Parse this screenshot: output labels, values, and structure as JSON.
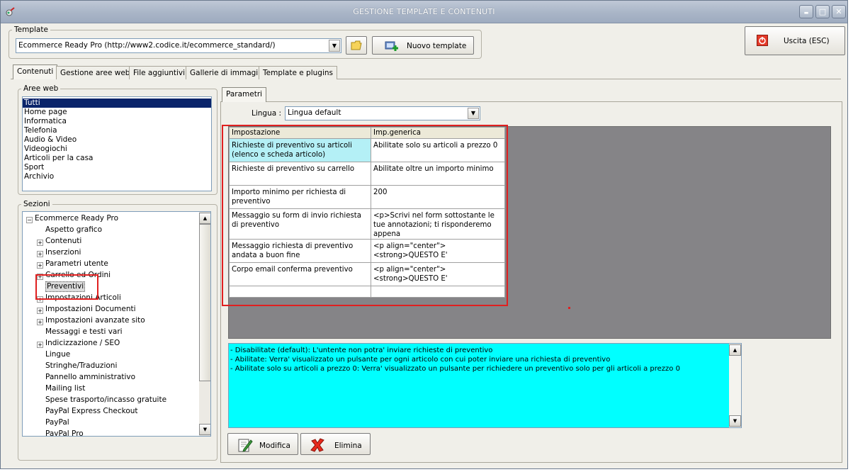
{
  "window": {
    "title": "GESTIONE TEMPLATE E CONTENUTI",
    "controls": {
      "minimize": "▬",
      "maximize": "□",
      "close": "✕"
    }
  },
  "template": {
    "group_label": "Template",
    "selected": "Ecommerce Ready Pro (http://www2.codice.it/ecommerce_standard/)",
    "new_template_label": "Nuovo template",
    "exit_label": "Uscita (ESC)"
  },
  "tabs": [
    "Contenuti",
    "Gestione aree web",
    "File aggiuntivi",
    "Gallerie di immagini",
    "Template e plugins"
  ],
  "aree_web": {
    "label": "Aree web",
    "items": [
      "Tutti",
      "Home page",
      "Informatica",
      "Telefonia",
      "Audio & Video",
      "Videogiochi",
      "Articoli per la casa",
      "Sport",
      "Archivio"
    ],
    "selected_index": 0
  },
  "sezioni": {
    "label": "Sezioni",
    "root": "Ecommerce Ready Pro",
    "items": [
      {
        "label": "Aspetto grafico",
        "expandable": false
      },
      {
        "label": "Contenuti",
        "expandable": true
      },
      {
        "label": "Inserzioni",
        "expandable": true
      },
      {
        "label": "Parametri utente",
        "expandable": true
      },
      {
        "label": "Carrello ed Ordini",
        "expandable": true
      },
      {
        "label": "Preventivi",
        "expandable": false,
        "selected": true
      },
      {
        "label": "Impostazioni Articoli",
        "expandable": true
      },
      {
        "label": "Impostazioni Documenti",
        "expandable": true
      },
      {
        "label": "Impostazioni avanzate sito",
        "expandable": true
      },
      {
        "label": "Messaggi e testi vari",
        "expandable": false
      },
      {
        "label": "Indicizzazione / SEO",
        "expandable": true
      },
      {
        "label": "Lingue",
        "expandable": false
      },
      {
        "label": "Stringhe/Traduzioni",
        "expandable": false
      },
      {
        "label": "Pannello amministrativo",
        "expandable": false
      },
      {
        "label": "Mailing list",
        "expandable": false
      },
      {
        "label": "Spese trasporto/incasso gratuite",
        "expandable": false
      },
      {
        "label": "PayPal Express Checkout",
        "expandable": false
      },
      {
        "label": "PayPal",
        "expandable": false
      },
      {
        "label": "PayPal Pro",
        "expandable": false
      }
    ]
  },
  "parametri": {
    "tab_label": "Parametri",
    "lingua_label": "Lingua :",
    "lingua_value": "Lingua default",
    "columns": [
      "Impostazione",
      "Imp.generica"
    ],
    "rows": [
      {
        "setting": "Richieste di preventivo su articoli (elenco e scheda articolo)",
        "value": "Abilitate solo su articoli a prezzo 0",
        "selected": true
      },
      {
        "setting": "Richieste di preventivo su carrello",
        "value": "Abilitate oltre un importo minimo"
      },
      {
        "setting": "Importo minimo per richiesta di preventivo",
        "value": "200"
      },
      {
        "setting": "Messaggio su form di invio richiesta di preventivo",
        "value": "<p>Scrivi nel form sottostante le tue annotazioni; ti risponderemo appena"
      },
      {
        "setting": "Messaggio richiesta di preventivo andata a buon fine",
        "value": "<p align=\"center\"><strong>QUESTO E'"
      },
      {
        "setting": "Corpo email conferma preventivo",
        "value": "<p align=\"center\"><strong>QUESTO E'"
      },
      {
        "setting": "",
        "value": ""
      }
    ]
  },
  "help_text": [
    "- Disabilitate (default): L'untente non potra' inviare richieste di preventivo",
    "- Abilitate: Verra' visualizzato un pulsante per ogni articolo con cui poter inviare una richiesta di preventivo",
    "- Abilitate solo su articoli a prezzo 0: Verra' visualizzato un pulsante per richiedere un preventivo solo per gli articoli a prezzo 0"
  ],
  "actions": {
    "modifica": "Modifica",
    "elimina": "Elimina"
  },
  "colors": {
    "highlight_box": "#e02020",
    "help_background": "#00ffff",
    "grid_area_background": "#858487",
    "selected_cell": "#b4f0f6",
    "list_selection": "#0a246a"
  },
  "icons": [
    "app-icon",
    "folder-icon",
    "add-template-icon",
    "exit-icon",
    "modify-icon",
    "delete-icon"
  ]
}
